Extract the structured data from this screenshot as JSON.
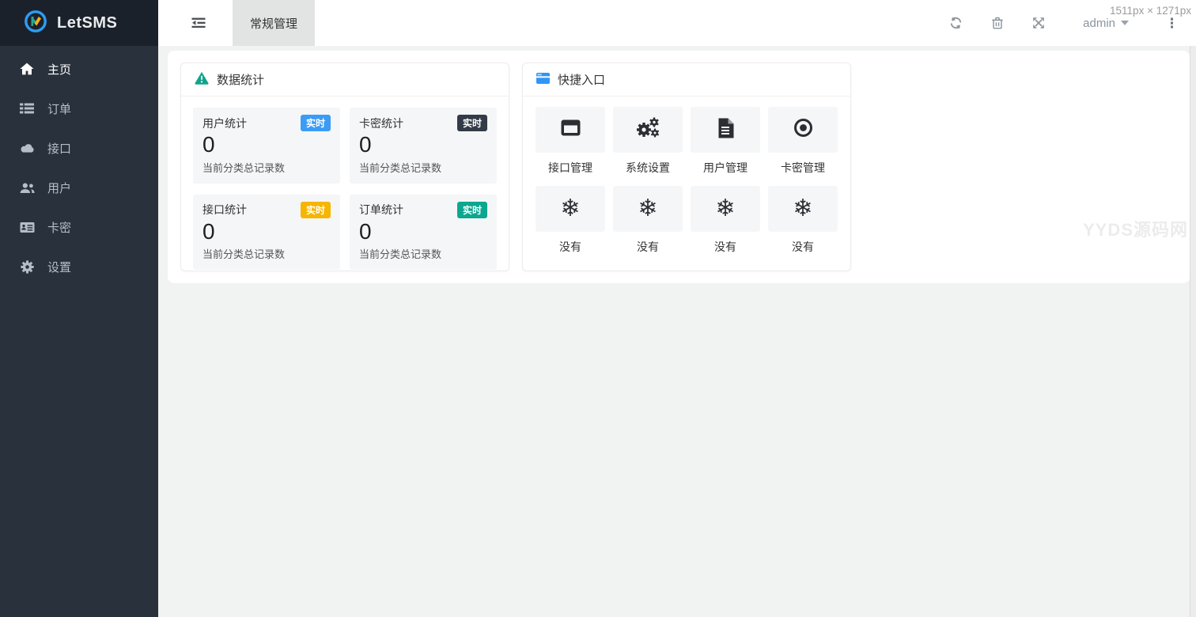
{
  "app": {
    "name": "LetSMS"
  },
  "viewport_badge": "1511px × 1271px",
  "sidebar": {
    "items": [
      {
        "label": "主页",
        "icon": "home-icon",
        "active": true
      },
      {
        "label": "订单",
        "icon": "orders-list-icon",
        "active": false
      },
      {
        "label": "接口",
        "icon": "api-cloud-icon",
        "active": false
      },
      {
        "label": "用户",
        "icon": "users-icon",
        "active": false
      },
      {
        "label": "卡密",
        "icon": "card-key-icon",
        "active": false
      },
      {
        "label": "设置",
        "icon": "settings-gear-icon",
        "active": false
      }
    ]
  },
  "header": {
    "active_tab": "常规管理",
    "username": "admin"
  },
  "colors": {
    "sidebar_bg": "#28313c",
    "page_bg": "#f1f2f2",
    "badge_blue": "#3b9cf6",
    "badge_dark": "#333b48",
    "badge_yellow": "#f6b500",
    "badge_teal": "#0ca78f",
    "stats_header_icon_teal": "#12a38c",
    "quick_header_icon_blue": "#2f96f6"
  },
  "stats_card": {
    "title": "数据统计",
    "items": [
      {
        "title": "用户统计",
        "badge": "实时",
        "badge_color": "#3b9cf6",
        "value": "0",
        "desc": "当前分类总记录数"
      },
      {
        "title": "卡密统计",
        "badge": "实时",
        "badge_color": "#333b48",
        "value": "0",
        "desc": "当前分类总记录数"
      },
      {
        "title": "接口统计",
        "badge": "实时",
        "badge_color": "#f6b500",
        "value": "0",
        "desc": "当前分类总记录数"
      },
      {
        "title": "订单统计",
        "badge": "实时",
        "badge_color": "#0ca78f",
        "value": "0",
        "desc": "当前分类总记录数"
      }
    ]
  },
  "quick_card": {
    "title": "快捷入口",
    "items": [
      {
        "label": "接口管理",
        "icon": "window-icon"
      },
      {
        "label": "系统设置",
        "icon": "cogs-icon"
      },
      {
        "label": "用户管理",
        "icon": "file-icon"
      },
      {
        "label": "卡密管理",
        "icon": "dot-circle-icon"
      },
      {
        "label": "没有",
        "icon": "snowflake-icon"
      },
      {
        "label": "没有",
        "icon": "snowflake-icon"
      },
      {
        "label": "没有",
        "icon": "snowflake-icon"
      },
      {
        "label": "没有",
        "icon": "snowflake-icon"
      }
    ]
  },
  "icons": {
    "snowflake": "❄",
    "kebab": "⋮"
  },
  "watermark": "YYDS源码网"
}
